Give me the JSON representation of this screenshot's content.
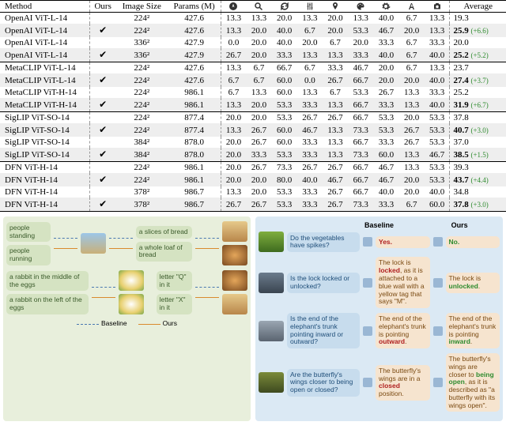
{
  "chart_data": {
    "type": "table",
    "columns": [
      "Method",
      "Ours",
      "Image Size",
      "Params (M)",
      "compass",
      "search",
      "refresh",
      "sliders",
      "pin",
      "palette",
      "gear",
      "font",
      "camera",
      "Average"
    ],
    "icon_columns": {
      "compass": "compass-icon",
      "search": "search-icon",
      "refresh": "refresh-icon",
      "sliders": "sliders-icon",
      "pin": "pin-icon",
      "palette": "palette-icon",
      "gear": "gear-icon",
      "font": "font-icon",
      "camera": "camera-icon"
    },
    "rows": [
      {
        "method": "OpenAI ViT-L-14",
        "ours": "",
        "img": "224²",
        "params": "427.6",
        "v": [
          "13.3",
          "13.3",
          "20.0",
          "13.3",
          "20.0",
          "13.3",
          "40.0",
          "6.7",
          "13.3"
        ],
        "avg": "19.3",
        "delta": "",
        "shade": false,
        "bold": false
      },
      {
        "method": "OpenAI ViT-L-14",
        "ours": "✔",
        "img": "224²",
        "params": "427.6",
        "v": [
          "13.3",
          "20.0",
          "40.0",
          "6.7",
          "20.0",
          "53.3",
          "46.7",
          "20.0",
          "13.3"
        ],
        "avg": "25.9",
        "delta": "(+6.6)",
        "shade": true,
        "bold": true
      },
      {
        "method": "OpenAI ViT-L-14",
        "ours": "",
        "img": "336²",
        "params": "427.9",
        "v": [
          "0.0",
          "20.0",
          "40.0",
          "20.0",
          "6.7",
          "20.0",
          "33.3",
          "6.7",
          "33.3"
        ],
        "avg": "20.0",
        "delta": "",
        "shade": false,
        "bold": false
      },
      {
        "method": "OpenAI ViT-L-14",
        "ours": "✔",
        "img": "336²",
        "params": "427.9",
        "v": [
          "26.7",
          "20.0",
          "33.3",
          "13.3",
          "13.3",
          "33.3",
          "40.0",
          "6.7",
          "40.0"
        ],
        "avg": "25.2",
        "delta": "(+5.2)",
        "shade": true,
        "bold": true
      },
      {
        "method": "MetaCLIP ViT-L-14",
        "ours": "",
        "img": "224²",
        "params": "427.6",
        "v": [
          "13.3",
          "6.7",
          "66.7",
          "6.7",
          "33.3",
          "46.7",
          "20.0",
          "6.7",
          "13.3"
        ],
        "avg": "23.7",
        "delta": "",
        "shade": false,
        "bold": false,
        "topline": true
      },
      {
        "method": "MetaCLIP ViT-L-14",
        "ours": "✔",
        "img": "224²",
        "params": "427.6",
        "v": [
          "6.7",
          "6.7",
          "60.0",
          "0.0",
          "26.7",
          "66.7",
          "20.0",
          "20.0",
          "40.0"
        ],
        "avg": "27.4",
        "delta": "(+3.7)",
        "shade": true,
        "bold": true
      },
      {
        "method": "MetaCLIP ViT-H-14",
        "ours": "",
        "img": "224²",
        "params": "986.1",
        "v": [
          "6.7",
          "13.3",
          "60.0",
          "13.3",
          "6.7",
          "53.3",
          "26.7",
          "13.3",
          "33.3"
        ],
        "avg": "25.2",
        "delta": "",
        "shade": false,
        "bold": false
      },
      {
        "method": "MetaCLIP ViT-H-14",
        "ours": "✔",
        "img": "224²",
        "params": "986.1",
        "v": [
          "13.3",
          "20.0",
          "53.3",
          "33.3",
          "13.3",
          "66.7",
          "33.3",
          "13.3",
          "40.0"
        ],
        "avg": "31.9",
        "delta": "(+6.7)",
        "shade": true,
        "bold": true
      },
      {
        "method": "SigLIP ViT-SO-14",
        "ours": "",
        "img": "224²",
        "params": "877.4",
        "v": [
          "20.0",
          "20.0",
          "53.3",
          "26.7",
          "26.7",
          "66.7",
          "53.3",
          "20.0",
          "53.3"
        ],
        "avg": "37.8",
        "delta": "",
        "shade": false,
        "bold": false,
        "topline": true
      },
      {
        "method": "SigLIP ViT-SO-14",
        "ours": "✔",
        "img": "224²",
        "params": "877.4",
        "v": [
          "13.3",
          "26.7",
          "60.0",
          "46.7",
          "13.3",
          "73.3",
          "53.3",
          "26.7",
          "53.3"
        ],
        "avg": "40.7",
        "delta": "(+3.0)",
        "shade": true,
        "bold": true
      },
      {
        "method": "SigLIP ViT-SO-14",
        "ours": "",
        "img": "384²",
        "params": "878.0",
        "v": [
          "20.0",
          "26.7",
          "60.0",
          "33.3",
          "13.3",
          "66.7",
          "33.3",
          "26.7",
          "53.3"
        ],
        "avg": "37.0",
        "delta": "",
        "shade": false,
        "bold": false
      },
      {
        "method": "SigLIP ViT-SO-14",
        "ours": "✔",
        "img": "384²",
        "params": "878.0",
        "v": [
          "20.0",
          "33.3",
          "53.3",
          "33.3",
          "13.3",
          "73.3",
          "60.0",
          "13.3",
          "46.7"
        ],
        "avg": "38.5",
        "delta": "(+1.5)",
        "shade": true,
        "bold": true
      },
      {
        "method": "DFN ViT-H-14",
        "ours": "",
        "img": "224²",
        "params": "986.1",
        "v": [
          "20.0",
          "26.7",
          "73.3",
          "26.7",
          "26.7",
          "66.7",
          "46.7",
          "13.3",
          "53.3"
        ],
        "avg": "39.3",
        "delta": "",
        "shade": false,
        "bold": false,
        "topline": true
      },
      {
        "method": "DFN ViT-H-14",
        "ours": "✔",
        "img": "224²",
        "params": "986.1",
        "v": [
          "20.0",
          "20.0",
          "80.0",
          "40.0",
          "46.7",
          "66.7",
          "46.7",
          "20.0",
          "53.3"
        ],
        "avg": "43.7",
        "delta": "(+4.4)",
        "shade": true,
        "bold": true
      },
      {
        "method": "DFN ViT-H-14",
        "ours": "",
        "img": "378²",
        "params": "986.7",
        "v": [
          "13.3",
          "20.0",
          "53.3",
          "33.3",
          "26.7",
          "66.7",
          "40.0",
          "20.0",
          "40.0"
        ],
        "avg": "34.8",
        "delta": "",
        "shade": false,
        "bold": false
      },
      {
        "method": "DFN ViT-H-14",
        "ours": "✔",
        "img": "378²",
        "params": "986.7",
        "v": [
          "26.7",
          "26.7",
          "53.3",
          "33.3",
          "26.7",
          "73.3",
          "33.3",
          "6.7",
          "60.0"
        ],
        "avg": "37.8",
        "delta": "(+3.0)",
        "shade": true,
        "bold": true
      }
    ]
  },
  "header": {
    "method": "Method",
    "ours": "Ours",
    "img": "Image Size",
    "params": "Params (M)",
    "avg": "Average"
  },
  "fig": {
    "left": {
      "p1a": "people\nstanding",
      "p1b": "people\nrunning",
      "p2a": "a slices of\nbread",
      "p2b": "a whole loaf\nof bread",
      "p3a": "a rabbit in\nthe middle\nof the eggs",
      "p3b": "a rabbit on the\nleft of the eggs",
      "p4a": "letter \"Q\"\nin it",
      "p4b": "letter \"X\"\nin it",
      "legendB": "Baseline",
      "legendO": "Ours"
    },
    "right": {
      "hB": "Baseline",
      "hO": "Ours",
      "q1": "Do the vegetables\nhave spikes?",
      "b1": "Yes.",
      "o1": "No.",
      "q2": "Is the lock locked\nor unlocked?",
      "b2p": "The lock is ",
      "b2r": "locked",
      "b2s": ", as it is attached to a blue wall with a yellow tag that says \"M\".",
      "o2p": "The lock is ",
      "o2g": "unlocked",
      "o2s": ".",
      "q3": "Is the end of the\nelephant's trunk\npointing inward\nor outward?",
      "b3p": "The end of the elephant's trunk is pointing ",
      "b3r": "outward",
      "b3s": ".",
      "o3p": "The end of the elephant's trunk is pointing ",
      "o3g": "inward",
      "o3s": ".",
      "q4": "Are the\nbutterfly's wings\ncloser to being\nopen or closed?",
      "b4p": "The butterfly's wings are in a ",
      "b4r": "closed",
      "b4s": " position.",
      "o4p": "The butterfly's wings are closer to ",
      "o4g": "being open",
      "o4s": ", as it is described as \"a butterfly with its wings open\"."
    }
  }
}
